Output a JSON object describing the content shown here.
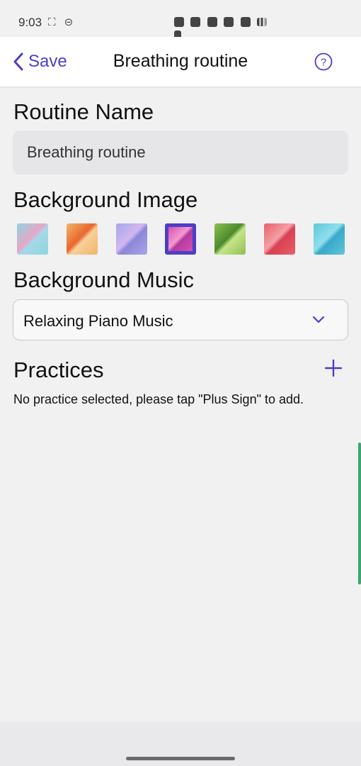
{
  "status_bar": {
    "time": "9:03",
    "left_icons": "⛶ ⊝"
  },
  "header": {
    "back_label": "Save",
    "title": "Breathing routine"
  },
  "routine_name": {
    "label": "Routine Name",
    "value": "Breathing routine"
  },
  "background_image": {
    "label": "Background Image",
    "swatches": [
      {
        "colors": [
          "#8fd5e0",
          "#e7a6c8",
          "#a6d8e8"
        ],
        "selected": false
      },
      {
        "colors": [
          "#f2b46a",
          "#e8672f",
          "#f6d09a"
        ],
        "selected": false
      },
      {
        "colors": [
          "#a8a6ea",
          "#d0b8f0",
          "#8d86d8"
        ],
        "selected": false
      },
      {
        "colors": [
          "#d94fb0",
          "#f29ad0",
          "#b43aa0"
        ],
        "selected": true
      },
      {
        "colors": [
          "#8ec050",
          "#4d8a2e",
          "#c6e48a"
        ],
        "selected": false
      },
      {
        "colors": [
          "#e85e6a",
          "#f4a0a8",
          "#d94050"
        ],
        "selected": false
      },
      {
        "colors": [
          "#5fc6dc",
          "#8ee0ec",
          "#3aa8c8"
        ],
        "selected": false
      }
    ]
  },
  "background_music": {
    "label": "Background Music",
    "selected": "Relaxing Piano Music"
  },
  "practices": {
    "label": "Practices",
    "empty_message": "No practice selected, please tap \"Plus Sign\" to add."
  },
  "colors": {
    "accent": "#4b3fc8",
    "background": "#f1f1f2"
  }
}
